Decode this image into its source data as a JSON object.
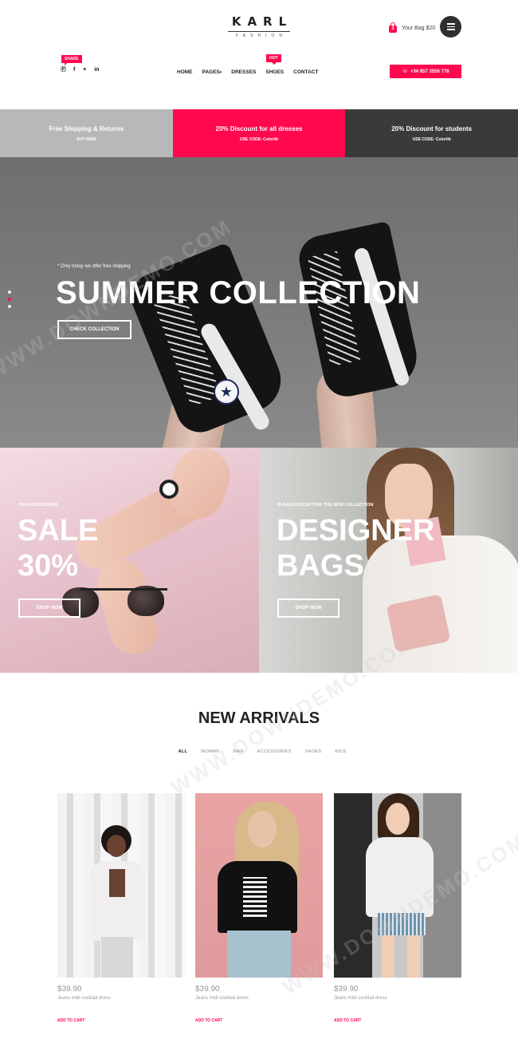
{
  "header": {
    "logo_main": "KARL",
    "logo_sub": "FASHION",
    "bag_label": "Your Bag $20",
    "bag_count": "3",
    "share_tag": "SHARE",
    "social": [
      "pinterest-icon",
      "facebook-icon",
      "twitter-icon",
      "linkedin-icon"
    ],
    "nav": [
      "HOME",
      "PAGES",
      "DRESSES",
      "SHOES",
      "CONTACT"
    ],
    "hot_tag": "HOT",
    "phone": "+34 657 3556 778"
  },
  "promo": [
    {
      "title": "Free Shipping & Returns",
      "sub": "BUY NOW"
    },
    {
      "title": "20% Discount for all dresses",
      "sub": "USE CODE: Colorlib"
    },
    {
      "title": "20% Discount for students",
      "sub": "USE CODE: Colorlib"
    }
  ],
  "hero": {
    "note": "* Only today we offer free shipping",
    "title": "SUMMER COLLECTION",
    "button": "CHECK COLLECTION",
    "active_slide": 2,
    "slide_count": 3
  },
  "banners": {
    "left": {
      "sub": "ON ACCESSORIES",
      "title_line1": "SALE",
      "title_line2": "30%",
      "button": "SHOP NOW"
    },
    "right": {
      "sub": "IN BAGS EXCEPTING THE NEW COLLECTION",
      "title_line1": "DESIGNER",
      "title_line2": "BAGS",
      "button": "SHOP NOW"
    }
  },
  "arrivals": {
    "title": "NEW ARRIVALS",
    "filters": [
      "ALL",
      "WOMAN",
      "MAN",
      "ACCESSORIES",
      "SHOES",
      "KIDS"
    ],
    "active_filter": "ALL",
    "products": [
      {
        "price": "$39.90",
        "name": "Jeans midi cocktail dress",
        "cart": "ADD TO CART"
      },
      {
        "price": "$39.90",
        "name": "Jeans midi cocktail dress",
        "cart": "ADD TO CART"
      },
      {
        "price": "$39.90",
        "name": "Jeans midi cocktail dress",
        "cart": "ADD TO CART"
      }
    ]
  },
  "colors": {
    "accent": "#ff084e",
    "dark": "#3a3a3a",
    "light_gray": "#b8b8b8"
  },
  "watermark": "WWW.DOWNDEMO.COM"
}
